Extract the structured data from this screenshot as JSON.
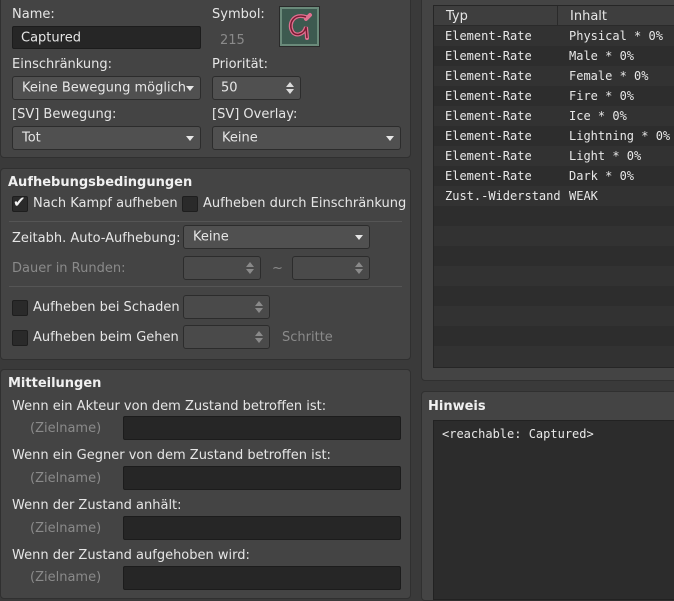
{
  "general": {
    "name_label": "Name:",
    "name_value": "Captured",
    "symbol_label": "Symbol:",
    "symbol_index": "215",
    "restriction_label": "Einschränkung:",
    "restriction_value": "Keine Bewegung möglich",
    "priority_label": "Priorität:",
    "priority_value": "50",
    "sv_motion_label": "[SV] Bewegung:",
    "sv_motion_value": "Tot",
    "sv_overlay_label": "[SV] Overlay:",
    "sv_overlay_value": "Keine"
  },
  "removal": {
    "title": "Aufhebungsbedingungen",
    "after_battle_label": "Nach Kampf aufheben",
    "after_battle_checked": true,
    "by_restriction_label": "Aufheben durch Einschränkung",
    "by_restriction_checked": false,
    "auto_removal_label": "Zeitabh. Auto-Aufhebung:",
    "auto_removal_value": "Keine",
    "duration_label": "Dauer in Runden:",
    "duration_sep": "~",
    "by_damage_label": "Aufheben bei Schaden",
    "by_walking_label": "Aufheben beim Gehen",
    "steps_label": "Schritte"
  },
  "messages": {
    "title": "Mitteilungen",
    "actor_label": "Wenn ein Akteur von dem Zustand betroffen ist:",
    "enemy_label": "Wenn ein Gegner von dem Zustand betroffen ist:",
    "persist_label": "Wenn der Zustand anhält:",
    "removed_label": "Wenn der Zustand aufgehoben wird:",
    "target_name": "(Zielname)"
  },
  "traits": {
    "col_type": "Typ",
    "col_content": "Inhalt",
    "rows": [
      {
        "type": "Element-Rate",
        "content": "Physical * 0%"
      },
      {
        "type": "Element-Rate",
        "content": "Male * 0%"
      },
      {
        "type": "Element-Rate",
        "content": "Female * 0%"
      },
      {
        "type": "Element-Rate",
        "content": "Fire * 0%"
      },
      {
        "type": "Element-Rate",
        "content": "Ice * 0%"
      },
      {
        "type": "Element-Rate",
        "content": "Lightning * 0%"
      },
      {
        "type": "Element-Rate",
        "content": "Light * 0%"
      },
      {
        "type": "Element-Rate",
        "content": "Dark * 0%"
      },
      {
        "type": "Zust.-Widerstand",
        "content": "WEAK"
      }
    ]
  },
  "note": {
    "title": "Hinweis",
    "text": "<reachable: Captured>"
  },
  "colors": {
    "background": "#3a3a3a",
    "panel": "#444444",
    "input": "#262626",
    "symbol_icon": "#d44a6a"
  },
  "icons": {
    "symbol": "magenta-rune-icon",
    "dropdown": "chevron-down-icon",
    "spinner": "spin-arrows-icon",
    "checkmark": "checkmark-icon"
  }
}
